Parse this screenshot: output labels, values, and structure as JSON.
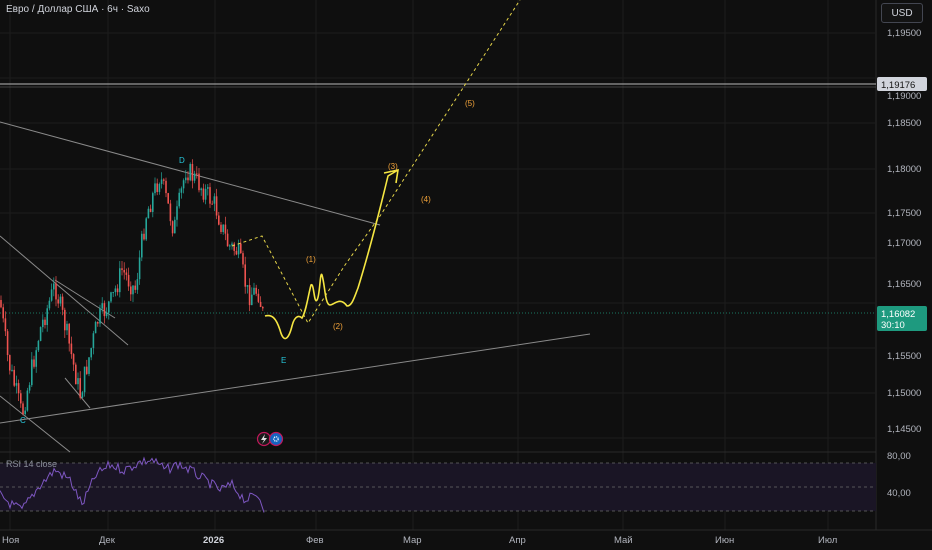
{
  "header": {
    "title": "Евро / Доллар США · 6ч · Saxo",
    "currency": "USD"
  },
  "price_axis": {
    "ticks": [
      "1,19500",
      "1,19000",
      "1,18500",
      "1,18000",
      "1,17500",
      "1,17000",
      "1,16500",
      "1,16000",
      "1,15500",
      "1,15000",
      "1,14500"
    ],
    "resistance_label": "1,19176",
    "current_price": "1,16082",
    "countdown": "30:10"
  },
  "rsi_axis": {
    "ticks": [
      "80,00",
      "40,00"
    ]
  },
  "time_axis": {
    "ticks": [
      "Ноя",
      "Дек",
      "2026",
      "Фев",
      "Мар",
      "Апр",
      "Май",
      "Июн",
      "Июл"
    ]
  },
  "wave_labels": {
    "C": "C",
    "D": "D",
    "E": "E",
    "w1": "(1)",
    "w2": "(2)",
    "w3": "(3)",
    "w4": "(4)",
    "w5": "(5)"
  },
  "rsi": {
    "title": "RSI 14 close"
  },
  "colors": {
    "background": "#0f0f0f",
    "bull": "#26a69a",
    "bear": "#ef5350",
    "forecast": "#f5e642",
    "wave_orange": "#f2a33a",
    "wave_teal": "#26c6da",
    "rsi_line": "#7e57c2",
    "price_badge": "#1e9a7f"
  },
  "icons": [
    "lightning-icon",
    "gear-icon"
  ]
}
